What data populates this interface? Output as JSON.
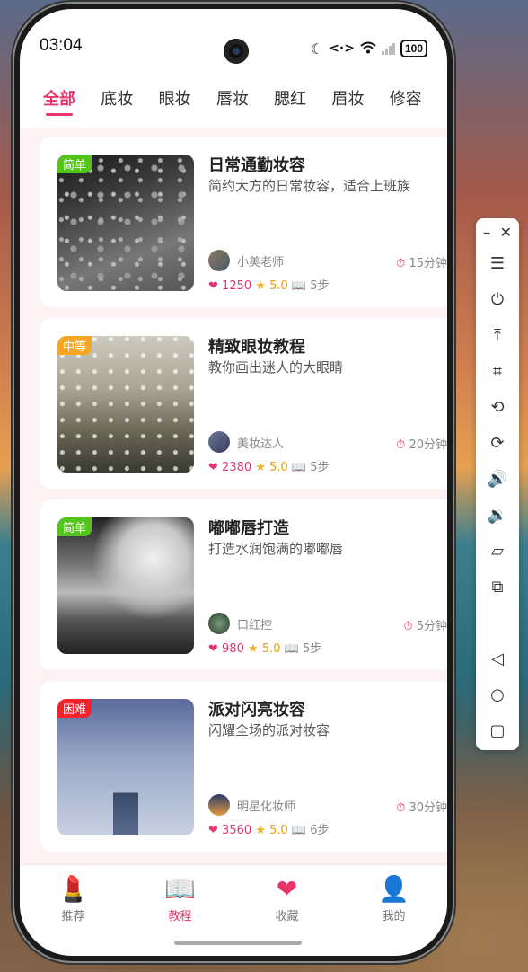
{
  "status": {
    "time": "03:04",
    "battery": "100"
  },
  "tabs": [
    "全部",
    "底妆",
    "眼妆",
    "唇妆",
    "腮红",
    "眉妆",
    "修容"
  ],
  "cards": [
    {
      "badge": "简单",
      "badge_color": "#52c41a",
      "title": "日常通勤妆容",
      "desc": "简约大方的日常妆容，适合上班族",
      "author": "小美老师",
      "duration": "15分钟",
      "likes": "1250",
      "rating": "5.0",
      "steps": "5步"
    },
    {
      "badge": "中等",
      "badge_color": "#f5a623",
      "title": "精致眼妆教程",
      "desc": "教你画出迷人的大眼睛",
      "author": "美妆达人",
      "duration": "20分钟",
      "likes": "2380",
      "rating": "5.0",
      "steps": "5步"
    },
    {
      "badge": "简单",
      "badge_color": "#52c41a",
      "title": "嘟嘟唇打造",
      "desc": "打造水润饱满的嘟嘟唇",
      "author": "口红控",
      "duration": "5分钟",
      "likes": "980",
      "rating": "5.0",
      "steps": "5步"
    },
    {
      "badge": "困难",
      "badge_color": "#f5222d",
      "title": "派对闪亮妆容",
      "desc": "闪耀全场的派对妆容",
      "author": "明星化妆师",
      "duration": "30分钟",
      "likes": "3560",
      "rating": "5.0",
      "steps": "6步"
    }
  ],
  "nav": [
    {
      "label": "推荐",
      "icon": "lipstick-icon"
    },
    {
      "label": "教程",
      "icon": "book-icon"
    },
    {
      "label": "收藏",
      "icon": "heart-icon"
    },
    {
      "label": "我的",
      "icon": "user-icon"
    }
  ],
  "colors": {
    "accent": "#e8336b"
  }
}
